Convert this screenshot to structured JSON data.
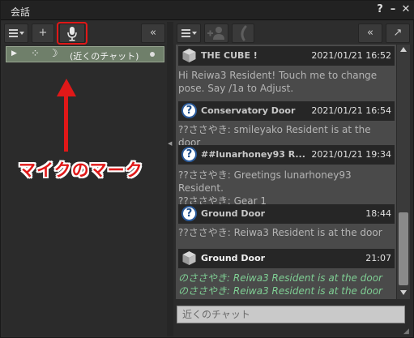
{
  "window": {
    "title": "会話",
    "help_label": "?",
    "minimize_label": "–",
    "close_label": "✕"
  },
  "left_toolbar": {
    "view_menu_icon": "list-menu-icon",
    "add_label": "+",
    "mic_icon": "microphone-icon",
    "collapse_label": "«"
  },
  "conversation": {
    "name": "(近くのチャット)"
  },
  "annotation": {
    "label": "マイクのマーク",
    "color": "#e01818"
  },
  "right_toolbar": {
    "view_menu_icon": "list-menu-icon",
    "add_friend_icon": "add-person-icon",
    "call_icon": "phone-icon",
    "collapse_label": "«",
    "tear_off_label": "↗"
  },
  "messages": [
    {
      "sender": "THE CUBE !",
      "time": "2021/01/21 16:52",
      "icon": "cube-icon",
      "lines": [
        "Hi Reiwa3 Resident! Touch me to change",
        "pose. Say /1a to Adjust."
      ]
    },
    {
      "sender": "Conservatory Door",
      "time": "2021/01/21 16:54",
      "icon": "question-icon",
      "lines": [
        "??ささやき: smileyako Resident is at the door"
      ]
    },
    {
      "sender": "##lunarhoney93 R...",
      "time": "2021/01/21 19:34",
      "icon": "question-icon",
      "lines": [
        "??ささやき: Greetings lunarhoney93 Resident.",
        "??ささやき: Gear 1"
      ]
    },
    {
      "sender": "Ground Door",
      "time": "18:44",
      "icon": "question-icon",
      "lines": [
        "??ささやき: Reiwa3 Resident is at the door"
      ]
    },
    {
      "sender": "Ground Door",
      "time": "21:07",
      "icon": "cube-icon",
      "lines": [
        "のささやき: Reiwa3 Resident is at the door",
        "のささやき: Reiwa3 Resident is at the door"
      ]
    }
  ],
  "chat_input": {
    "placeholder": "近くのチャット"
  },
  "colors": {
    "selected_row": "#6f7f6a",
    "green_text": "#7fcf94",
    "accent_red": "#e01818"
  }
}
